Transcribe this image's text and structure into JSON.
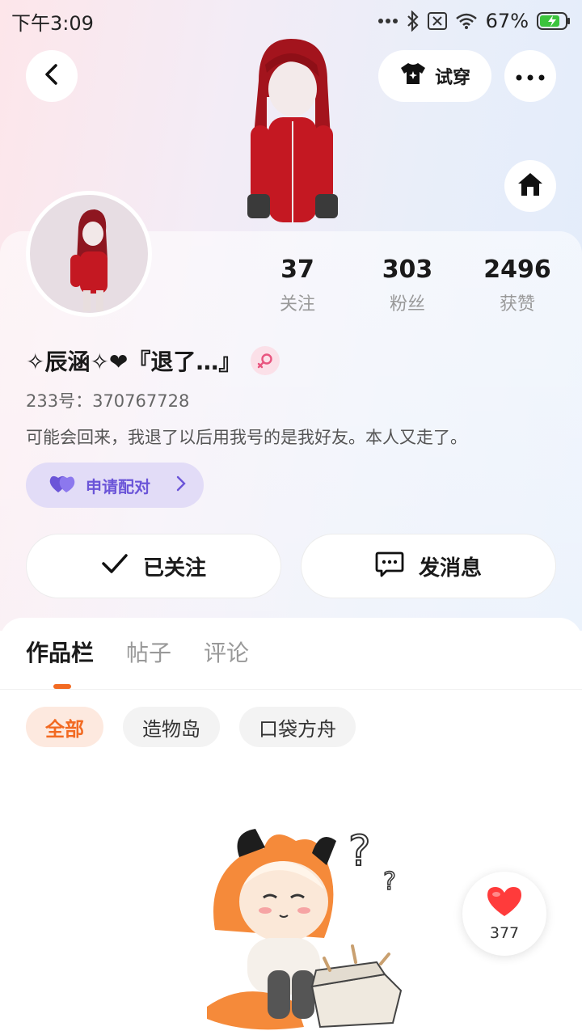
{
  "status_bar": {
    "time": "下午3:09",
    "battery": "67%"
  },
  "header": {
    "try_on_label": "试穿"
  },
  "stats": [
    {
      "value": "37",
      "label": "关注"
    },
    {
      "value": "303",
      "label": "粉丝"
    },
    {
      "value": "2496",
      "label": "获赞"
    }
  ],
  "profile": {
    "nickname": "✧辰涵✧❤『退了…』",
    "uid": "233号：370767728",
    "bio": "可能会回来，我退了以后用我号的是我好友。本人又走了。",
    "match_label": "申请配对"
  },
  "actions": {
    "follow_label": "已关注",
    "message_label": "发消息"
  },
  "tabs": [
    "作品栏",
    "帖子",
    "评论"
  ],
  "filters": [
    "全部",
    "造物岛",
    "口袋方舟"
  ],
  "like_fab": {
    "count": "377"
  },
  "colors": {
    "accent": "#f26a22",
    "match": "#6b55d8",
    "heart": "#ff3b3b"
  }
}
